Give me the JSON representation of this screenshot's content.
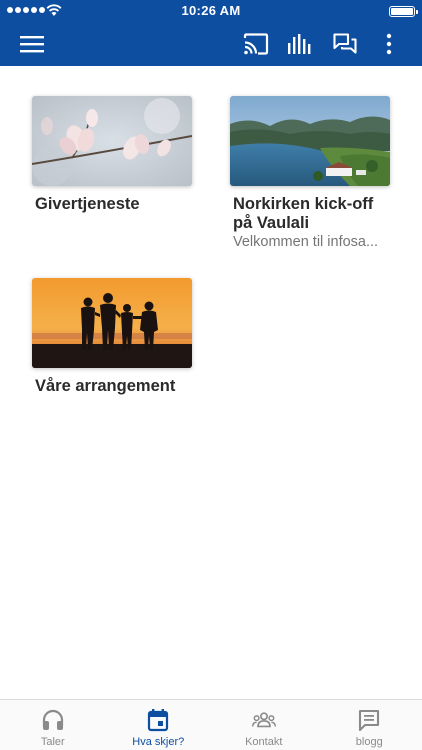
{
  "status_bar": {
    "time": "10:26 AM"
  },
  "header": {
    "icons": [
      "menu-icon",
      "cast-icon",
      "equalizer-icon",
      "chat-icon",
      "more-vert-icon"
    ]
  },
  "cards": [
    {
      "title": "Givertjeneste",
      "subtitle": ""
    },
    {
      "title": "Norkirken kick-off på Vaulali",
      "subtitle": "Velkommen til infosa..."
    },
    {
      "title": "Våre arrangement",
      "subtitle": ""
    }
  ],
  "bottom_nav": {
    "active_index": 1,
    "active_color": "#0d4ea1",
    "tabs": [
      {
        "label": "Taler",
        "icon": "headphones-icon"
      },
      {
        "label": "Hva skjer?",
        "icon": "calendar-icon"
      },
      {
        "label": "Kontakt",
        "icon": "people-icon"
      },
      {
        "label": "blogg",
        "icon": "comment-icon"
      }
    ]
  },
  "colors": {
    "primary": "#0d4ea1",
    "inactive": "#8a8a8a"
  }
}
